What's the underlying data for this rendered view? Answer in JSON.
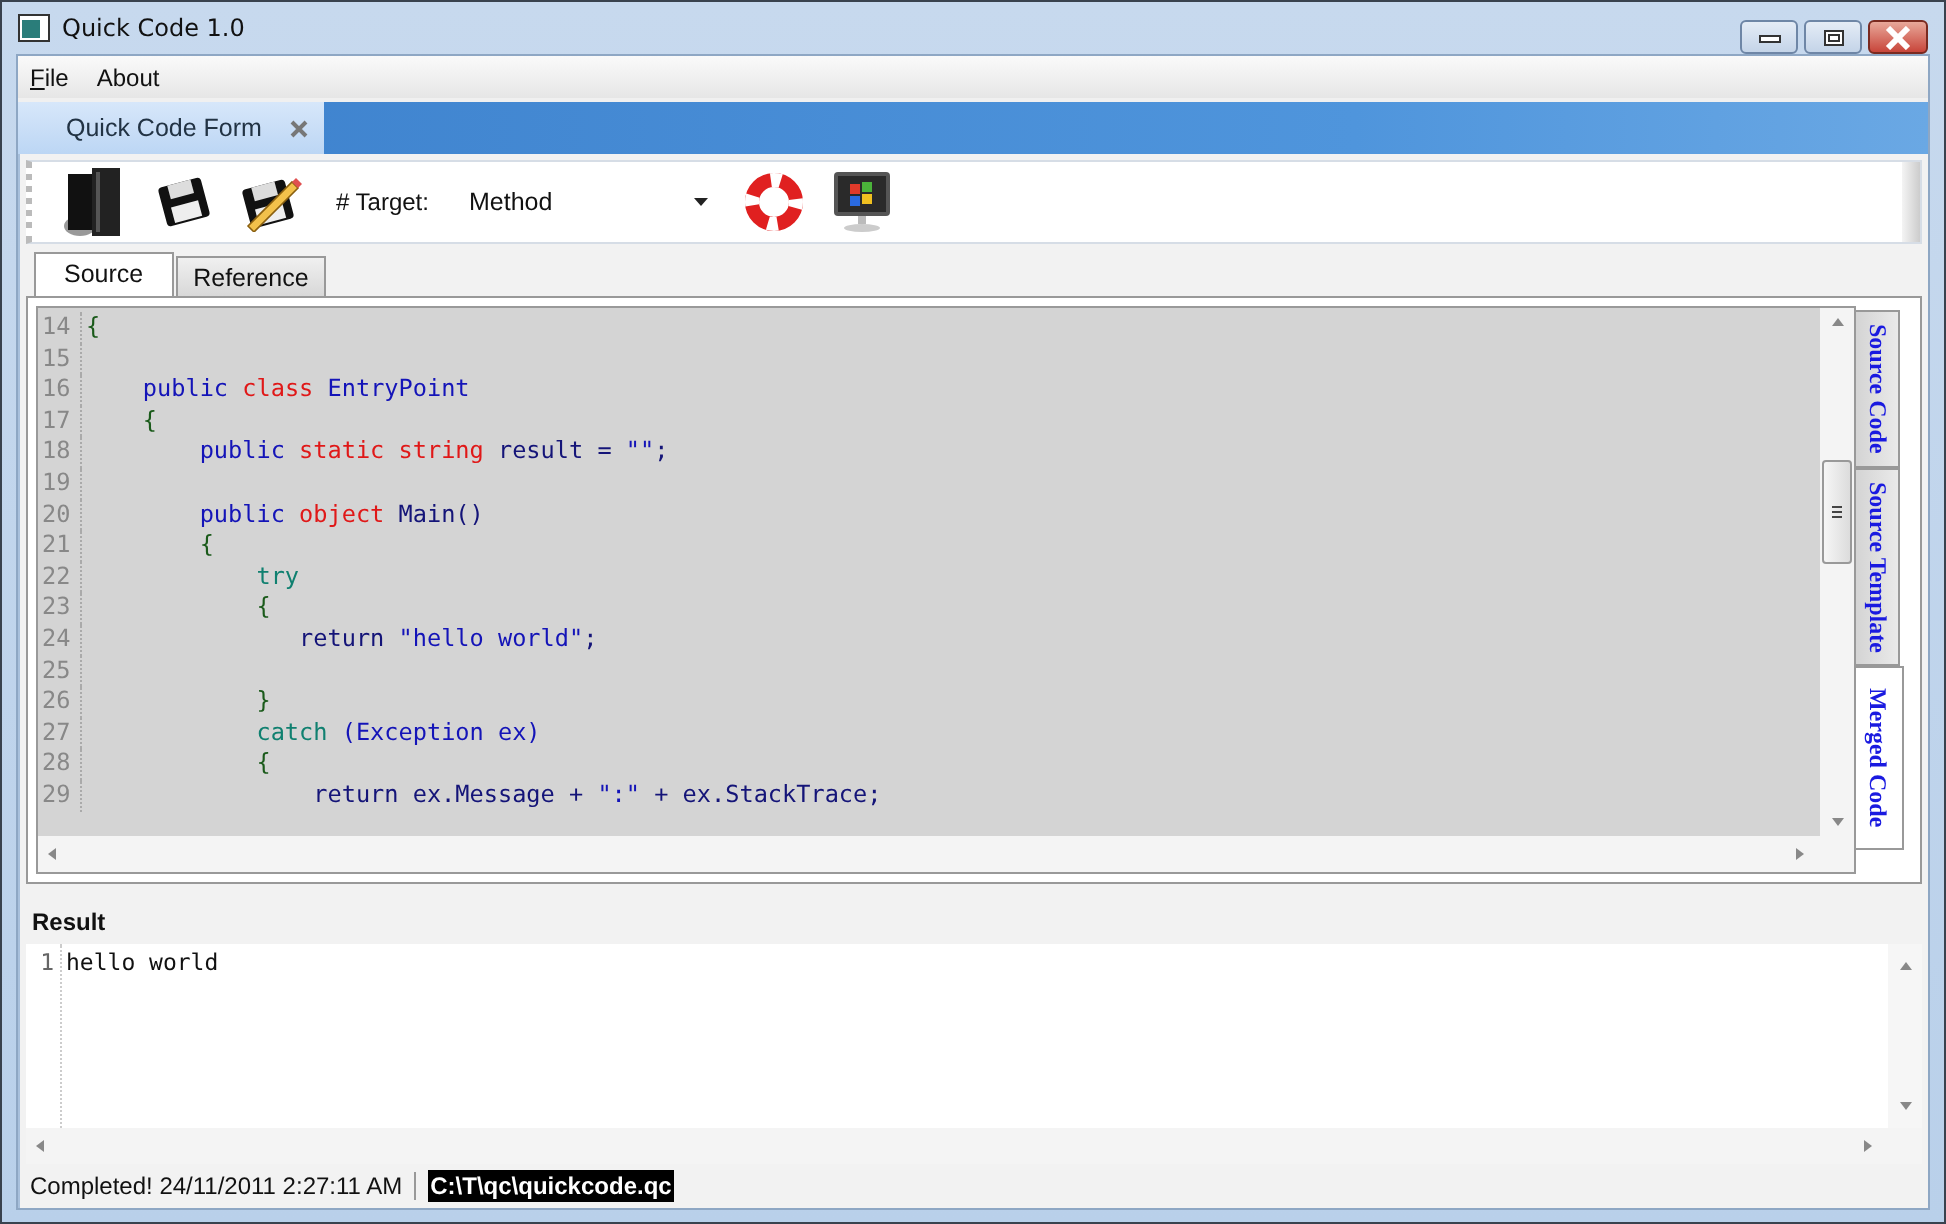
{
  "window": {
    "title": "Quick Code 1.0"
  },
  "menu": [
    {
      "label": "File",
      "mnemonic_underlined": true
    },
    {
      "label": "About",
      "mnemonic_underlined": false
    }
  ],
  "document_tabs": [
    {
      "label": "Quick Code Form",
      "selected": true
    }
  ],
  "toolbar": {
    "target_label": "# Target:",
    "target_value": "Method"
  },
  "editor_tabs": [
    {
      "label": "Source",
      "selected": true
    },
    {
      "label": "Reference",
      "selected": false
    }
  ],
  "code_lines": [
    {
      "number": "14",
      "tokens": [
        {
          "kind": "punct",
          "text": "{"
        }
      ]
    },
    {
      "number": "15"
    },
    {
      "number": "16",
      "tokens": [
        {
          "kind": "kw",
          "text": "    public"
        },
        {
          "kind": "type",
          "text": " class"
        },
        {
          "kind": "kw",
          "text": " EntryPoint"
        }
      ]
    },
    {
      "number": "17",
      "tokens": [
        {
          "kind": "punct",
          "text": "    {"
        }
      ]
    },
    {
      "number": "18",
      "tokens": [
        {
          "kind": "kw",
          "text": "        public"
        },
        {
          "kind": "type",
          "text": " static string"
        },
        {
          "kind": "ident",
          "text": " result = "
        },
        {
          "kind": "str",
          "text": "\"\""
        },
        {
          "kind": "ident",
          "text": ";"
        }
      ]
    },
    {
      "number": "19"
    },
    {
      "number": "20",
      "tokens": [
        {
          "kind": "kw",
          "text": "        public"
        },
        {
          "kind": "type",
          "text": " object"
        },
        {
          "kind": "ident",
          "text": " Main()"
        }
      ]
    },
    {
      "number": "21",
      "tokens": [
        {
          "kind": "punct",
          "text": "        {"
        }
      ]
    },
    {
      "number": "22",
      "tokens": [
        {
          "kind": "ctrl",
          "text": "            try"
        }
      ]
    },
    {
      "number": "23",
      "tokens": [
        {
          "kind": "punct",
          "text": "            {"
        }
      ]
    },
    {
      "number": "24",
      "tokens": [
        {
          "kind": "ident",
          "text": "               return "
        },
        {
          "kind": "str",
          "text": "\"hello world\""
        },
        {
          "kind": "ident",
          "text": ";"
        }
      ]
    },
    {
      "number": "25"
    },
    {
      "number": "26",
      "tokens": [
        {
          "kind": "punct",
          "text": "            }"
        }
      ]
    },
    {
      "number": "27",
      "tokens": [
        {
          "kind": "ctrl",
          "text": "            catch"
        },
        {
          "kind": "kw",
          "text": " (Exception ex)"
        }
      ]
    },
    {
      "number": "28",
      "tokens": [
        {
          "kind": "punct",
          "text": "            {"
        }
      ]
    },
    {
      "number": "29",
      "tokens": [
        {
          "kind": "ident",
          "text": "                return ex.Message + "
        },
        {
          "kind": "str",
          "text": "\":\""
        },
        {
          "kind": "ident",
          "text": " + ex.StackTrace;"
        }
      ]
    }
  ],
  "side_tabs": [
    {
      "label": "Source Code",
      "selected": false
    },
    {
      "label": "Source Template",
      "selected": false
    },
    {
      "label": "Merged Code",
      "selected": true
    }
  ],
  "result": {
    "title": "Result",
    "lines": [
      {
        "number": "1",
        "text": "hello world"
      }
    ]
  },
  "status_bar": {
    "message": "Completed! 24/11/2011 2:27:11 AM",
    "path": "C:\\T\\qc\\quickcode.qc"
  }
}
